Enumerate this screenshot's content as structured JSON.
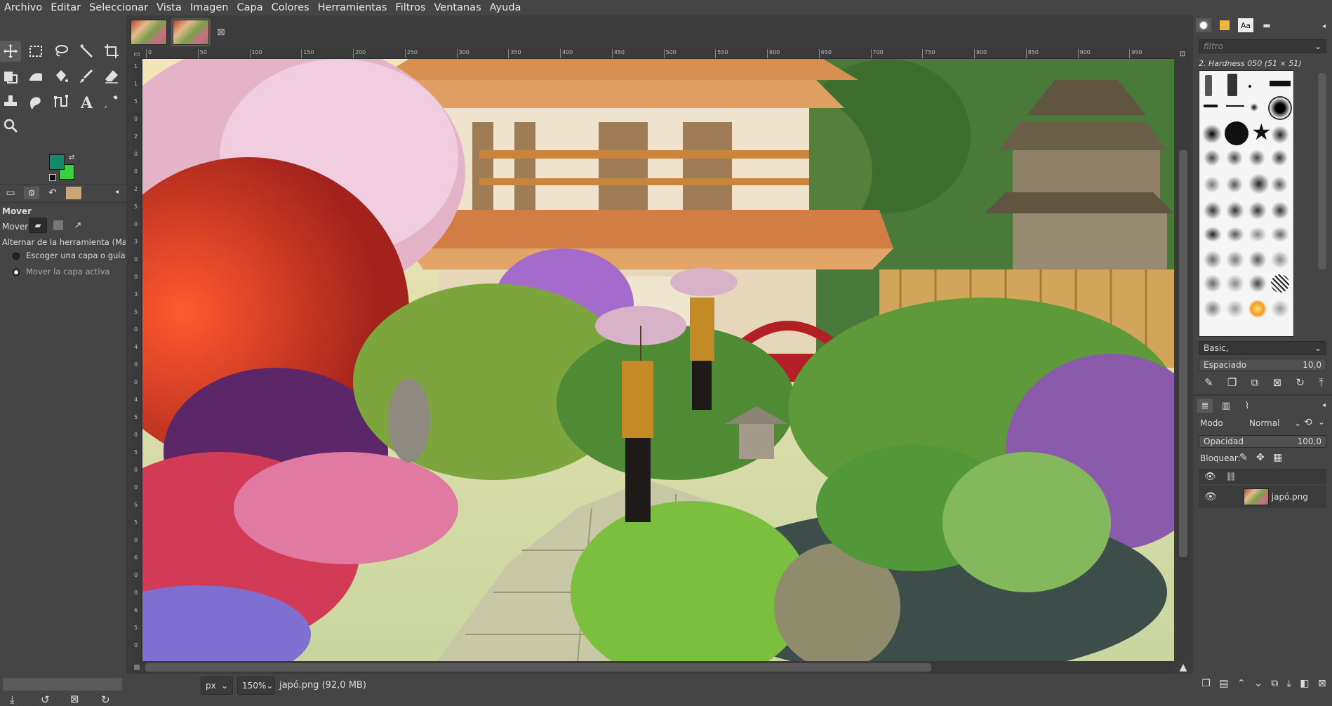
{
  "menu": [
    "Archivo",
    "Editar",
    "Seleccionar",
    "Vista",
    "Imagen",
    "Capa",
    "Colores",
    "Herramientas",
    "Filtros",
    "Ventanas",
    "Ayuda"
  ],
  "toolbox": {
    "tools": [
      "move-tool",
      "rect-select-tool",
      "free-select-tool",
      "fuzzy-select-tool",
      "crop-tool",
      "unified-transform-tool",
      "warp-transform-tool",
      "bucket-fill-tool",
      "paintbrush-tool",
      "eraser-tool",
      "clone-tool",
      "smudge-tool",
      "paths-tool",
      "text-tool",
      "color-picker-tool",
      "zoom-tool"
    ],
    "fg_color": "#138a6a",
    "bg_color": "#39d13c",
    "options_title": "Mover",
    "move_label": "Mover:",
    "toggle_label": "Alternar de la herramienta  (Mayu",
    "radio_pick": "Escoger una capa o guía",
    "radio_move": "Mover la capa activa"
  },
  "canvas": {
    "ruler_ticks": [
      "0",
      "50",
      "100",
      "150",
      "200",
      "250",
      "300",
      "350",
      "400",
      "450",
      "500",
      "550",
      "600",
      "650",
      "700",
      "750",
      "800",
      "850",
      "900",
      "950"
    ],
    "vruler_ticks": [
      "1",
      "1",
      "5",
      "0",
      "2",
      "0",
      "0",
      "2",
      "5",
      "0",
      "3",
      "0",
      "0",
      "3",
      "5",
      "0",
      "4",
      "0",
      "0",
      "4",
      "5",
      "0",
      "5",
      "0",
      "0",
      "5",
      "5",
      "0",
      "6",
      "0",
      "0",
      "6",
      "5",
      "0"
    ]
  },
  "status": {
    "unit": "px",
    "zoom": "150%",
    "file": "japó.png (92,0 MB)"
  },
  "dock": {
    "filter_placeholder": "filtro",
    "brush_name": "2. Hardness 050 (51 × 51)",
    "preset": "Basic,",
    "spacing_label": "Espaciado",
    "spacing_value": "10,0",
    "mode_label": "Modo",
    "mode_value": "Normal",
    "opacity_label": "Opacidad",
    "opacity_value": "100,0",
    "lock_label": "Bloquear:",
    "layer_name": "japó.png"
  }
}
